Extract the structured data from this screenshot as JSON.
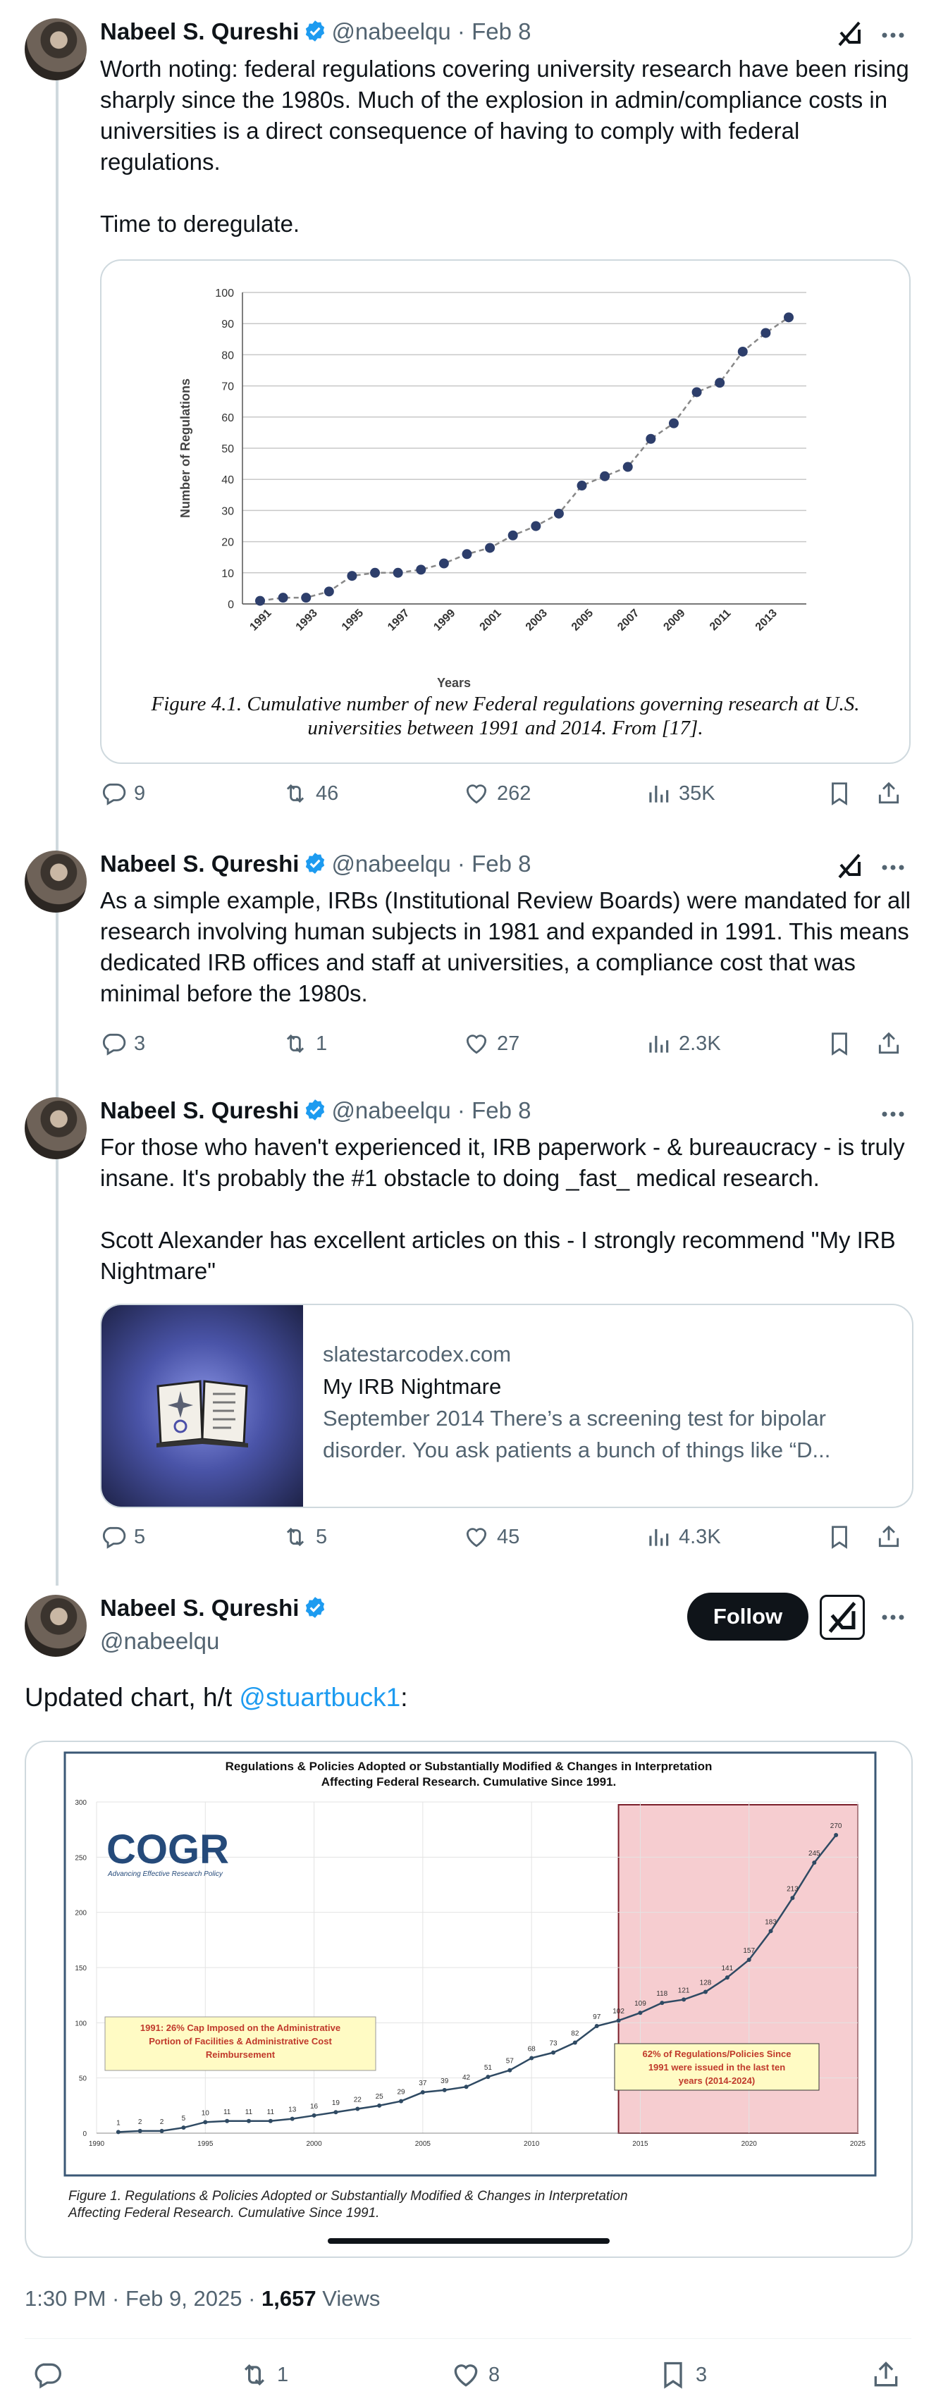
{
  "author": {
    "name": "Nabeel S. Qureshi",
    "handle": "@nabeelqu"
  },
  "tweets": [
    {
      "date": "Feb 8",
      "paragraphs": [
        "Worth noting: federal regulations covering university research have been rising sharply since the 1980s. Much of the explosion in admin/compliance costs in universities is a direct consequence of having to comply with federal regulations.",
        "Time to deregulate."
      ],
      "stats": {
        "replies": "9",
        "reposts": "46",
        "likes": "262",
        "views": "35K"
      }
    },
    {
      "date": "Feb 8",
      "paragraphs": [
        "As a simple example, IRBs (Institutional Review Boards) were mandated for all research involving human subjects in 1981 and expanded in 1991. This means dedicated IRB offices and staff at universities, a compliance cost that was minimal before the 1980s."
      ],
      "stats": {
        "replies": "3",
        "reposts": "1",
        "likes": "27",
        "views": "2.3K"
      }
    },
    {
      "date": "Feb 8",
      "paragraphs": [
        "For those who haven't experienced it, IRB paperwork - & bureaucracy - is truly insane. It's probably the #1 obstacle to doing _fast_ medical research.",
        "Scott Alexander has excellent articles on this - I strongly recommend \"My IRB Nightmare\""
      ],
      "link_card": {
        "domain": "slatestarcodex.com",
        "title": "My IRB Nightmare",
        "description_line1": "September 2014 There’s a screening test for bipolar",
        "description_line2": "disorder. You ask patients a bunch of things like “D..."
      },
      "stats": {
        "replies": "5",
        "reposts": "5",
        "likes": "45",
        "views": "4.3K"
      }
    }
  ],
  "main_tweet": {
    "text_prefix": "Updated chart, h/t ",
    "mention": "@stuartbuck1",
    "text_suffix": ":",
    "follow_label": "Follow",
    "timestamp": "1:30 PM · Feb 9, 2025 · ",
    "views_count": "1,657",
    "views_label": " Views",
    "stats": {
      "reposts": "1",
      "likes": "8",
      "bookmarks": "3"
    }
  },
  "chart_data": [
    {
      "type": "line",
      "title": "",
      "xlabel": "Years",
      "ylabel": "Number of Regulations",
      "x": [
        1991,
        1992,
        1993,
        1994,
        1995,
        1996,
        1997,
        1998,
        1999,
        2000,
        2001,
        2002,
        2003,
        2004,
        2005,
        2006,
        2007,
        2008,
        2009,
        2010,
        2011,
        2012,
        2013,
        2014
      ],
      "values": [
        1,
        2,
        2,
        4,
        9,
        10,
        10,
        11,
        13,
        16,
        18,
        22,
        25,
        29,
        38,
        41,
        44,
        53,
        58,
        68,
        71,
        81,
        87,
        92
      ],
      "ylim": [
        0,
        100
      ],
      "yticks": [
        0,
        10,
        20,
        30,
        40,
        50,
        60,
        70,
        80,
        90,
        100
      ],
      "xtick_labels": [
        "1991",
        "1993",
        "1995",
        "1997",
        "1999",
        "2001",
        "2003",
        "2005",
        "2007",
        "2009",
        "2011",
        "2013"
      ],
      "caption_line1": "Figure 4.1.  Cumulative number of new Federal regulations governing research at U.S.",
      "caption_line2": "universities between 1991 and 2014.  From [17].",
      "grid": true
    },
    {
      "type": "line",
      "title_line1": "Regulations & Policies Adopted or Substantially Modified & Changes in Interpretation",
      "title_line2": "Affecting Federal Research. Cumulative Since 1991.",
      "logo": "COGR",
      "logo_tagline": "Advancing Effective Research Policy",
      "x": [
        1991,
        1992,
        1993,
        1994,
        1995,
        1996,
        1997,
        1998,
        1999,
        2000,
        2001,
        2002,
        2003,
        2004,
        2005,
        2006,
        2007,
        2008,
        2009,
        2010,
        2011,
        2012,
        2013,
        2014,
        2015,
        2016,
        2017,
        2018,
        2019,
        2020,
        2021,
        2022,
        2023,
        2024
      ],
      "values": [
        1,
        2,
        2,
        5,
        10,
        11,
        11,
        11,
        13,
        16,
        19,
        22,
        25,
        29,
        37,
        39,
        42,
        51,
        57,
        68,
        73,
        82,
        97,
        102,
        109,
        118,
        121,
        128,
        141,
        157,
        183,
        213,
        245,
        270
      ],
      "ylim": [
        0,
        300
      ],
      "yticks": [
        0,
        50,
        100,
        150,
        200,
        250,
        300
      ],
      "xlim": [
        1990,
        2025
      ],
      "xtick_labels": [
        "1990",
        "1995",
        "2000",
        "2005",
        "2010",
        "2015",
        "2020",
        "2025"
      ],
      "highlight_range": [
        2014,
        2025
      ],
      "annotation_left_line1": "1991:  26% Cap Imposed on the Administrative",
      "annotation_left_line2": "Portion of Facilities & Administrative Cost",
      "annotation_left_line3": "Reimbursement",
      "annotation_right_line1": "62% of Regulations/Policies Since",
      "annotation_right_line2": "1991 were issued in the last ten",
      "annotation_right_line3": "years (2014-2024)",
      "caption_line1": "Figure 1.  Regulations & Policies Adopted or Substantially Modified & Changes in Interpretation",
      "caption_line2": "Affecting Federal Research.  Cumulative Since 1991.",
      "colors": {
        "line": "#2f4a63",
        "highlight": "#f6cdd0",
        "note": "#fffbc4",
        "note_text": "#c0392b"
      }
    }
  ]
}
